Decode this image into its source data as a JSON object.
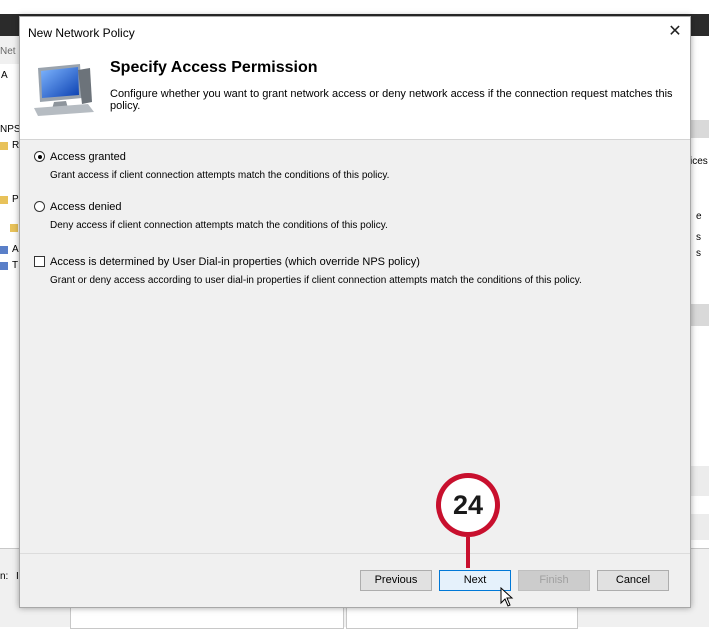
{
  "background": {
    "left_fragments": [
      "Net",
      "A",
      "NPS",
      "R",
      "P",
      "A",
      "T"
    ],
    "right_fragments": [
      "ices",
      "e",
      "s",
      "s"
    ],
    "bottom_label": "n:",
    "bottom_label_right": "I"
  },
  "dialog": {
    "window_title": "New Network Policy",
    "heading": "Specify Access Permission",
    "description": "Configure whether you want to grant network access or deny network access if the connection request matches this policy.",
    "icon": "network-monitor-icon"
  },
  "options": [
    {
      "label": "Access granted",
      "description": "Grant access if client connection attempts match the conditions of this policy.",
      "selected": true
    },
    {
      "label": "Access denied",
      "description": "Deny access if client connection attempts match the conditions of this policy.",
      "selected": false
    }
  ],
  "dialin_option": {
    "label": "Access is determined by User Dial-in properties (which override NPS policy)",
    "description": "Grant or deny access according to user dial-in properties if client connection attempts match the conditions of this policy.",
    "checked": false
  },
  "buttons": {
    "previous": "Previous",
    "next": "Next",
    "finish": "Finish",
    "cancel": "Cancel"
  },
  "annotation": {
    "step_number": "24",
    "color": "#c8102e"
  }
}
